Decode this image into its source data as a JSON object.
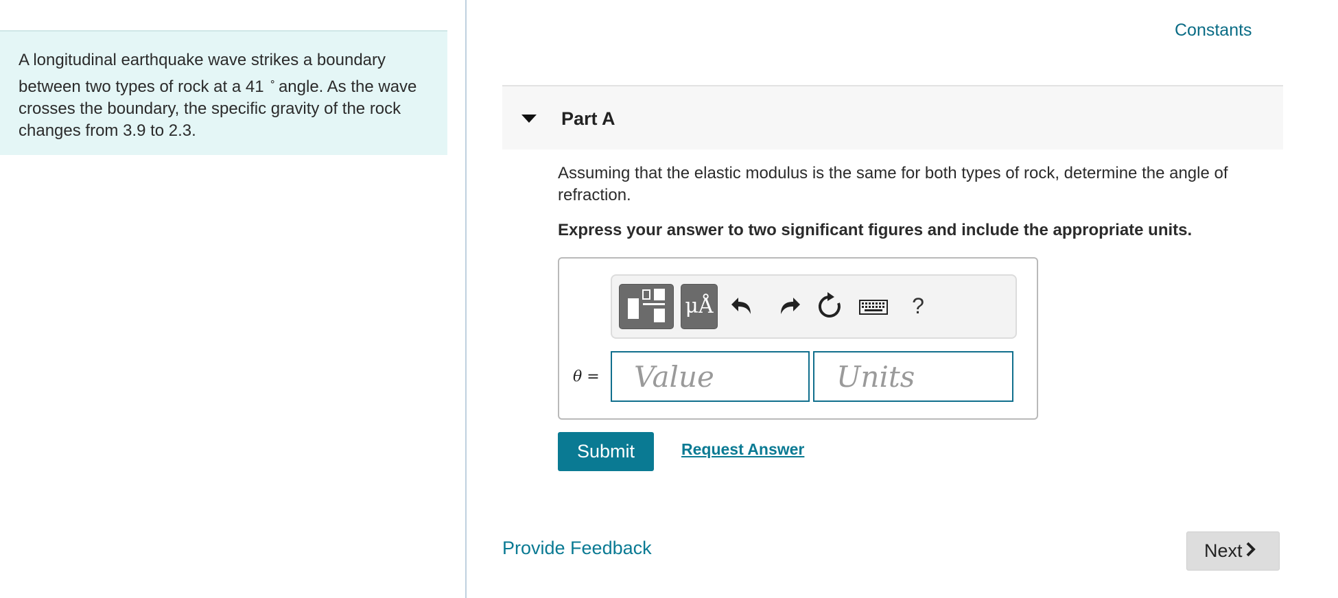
{
  "problem": {
    "text_before": "A longitudinal earthquake wave strikes a boundary between two types of rock at a 41",
    "degree_symbol": "∘",
    "text_after": "angle. As the wave crosses the boundary, the specific gravity of the rock changes from 3.9 to 2.3."
  },
  "header": {
    "constants_link": "Constants"
  },
  "part": {
    "title": "Part A",
    "question": "Assuming that the elastic modulus is the same for both types of rock, determine the angle of refraction.",
    "instruction": "Express your answer to two significant figures and include the appropriate units."
  },
  "toolbar": {
    "templates_icon": "fraction-template-icon",
    "symbols_label": "μÅ",
    "undo_icon": "undo-icon",
    "redo_icon": "redo-icon",
    "reset_icon": "reset-icon",
    "keyboard_icon": "keyboard-icon",
    "help_label": "?"
  },
  "answer": {
    "variable_symbol": "θ",
    "equals": "=",
    "value_placeholder": "Value",
    "units_placeholder": "Units"
  },
  "actions": {
    "submit_label": "Submit",
    "request_answer_label": "Request Answer"
  },
  "footer": {
    "feedback_label": "Provide Feedback",
    "next_label": "Next"
  },
  "colors": {
    "accent": "#0a7a93",
    "problem_bg": "#e4f6f6",
    "input_border": "#0f6e8c"
  }
}
